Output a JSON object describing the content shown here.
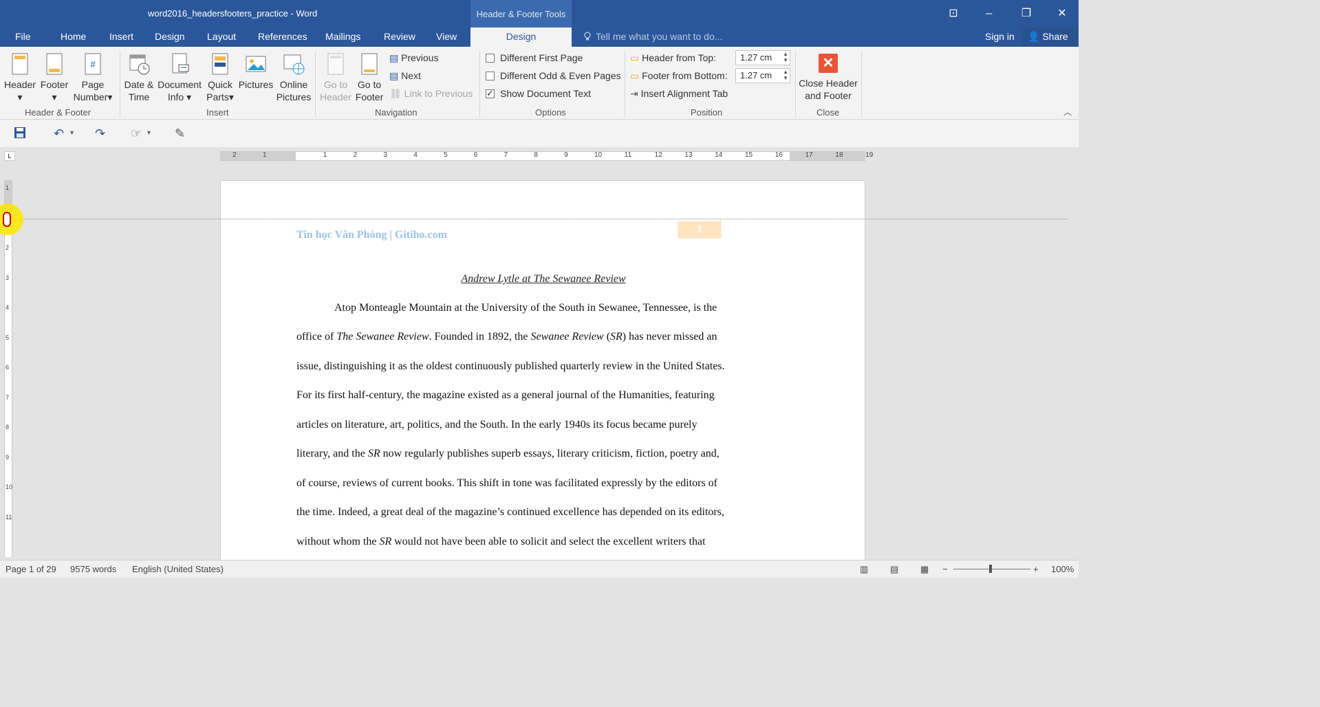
{
  "window": {
    "title": "word2016_headersfooters_practice - Word",
    "context_tab_group": "Header & Footer Tools"
  },
  "tabs": [
    "File",
    "Home",
    "Insert",
    "Design",
    "Layout",
    "References",
    "Mailings",
    "Review",
    "View",
    "Design"
  ],
  "tell_me_placeholder": "Tell me what you want to do...",
  "account": {
    "signin": "Sign in",
    "share": "Share"
  },
  "ribbon": {
    "header_footer_group": {
      "label": "Header & Footer",
      "header": "Header",
      "footer": "Footer",
      "page_number_1": "Page",
      "page_number_2": "Number"
    },
    "insert_group": {
      "label": "Insert",
      "date_time_1": "Date &",
      "date_time_2": "Time",
      "document_info_1": "Document",
      "document_info_2": "Info",
      "quick_parts_1": "Quick",
      "quick_parts_2": "Parts",
      "pictures": "Pictures",
      "online_pictures_1": "Online",
      "online_pictures_2": "Pictures"
    },
    "navigation_group": {
      "label": "Navigation",
      "goto_header_1": "Go to",
      "goto_header_2": "Header",
      "goto_footer_1": "Go to",
      "goto_footer_2": "Footer",
      "previous": "Previous",
      "next": "Next",
      "link_to_previous": "Link to Previous"
    },
    "options_group": {
      "label": "Options",
      "different_first_page": "Different First Page",
      "different_odd_even": "Different Odd & Even Pages",
      "show_document_text": "Show Document Text",
      "different_first_page_checked": false,
      "different_odd_even_checked": false,
      "show_document_text_checked": true
    },
    "position_group": {
      "label": "Position",
      "header_from_top": "Header from Top:",
      "header_from_top_value": "1.27 cm",
      "footer_from_bottom": "Footer from Bottom:",
      "footer_from_bottom_value": "1.27 cm",
      "insert_alignment_tab": "Insert Alignment Tab"
    },
    "close_group": {
      "label": "Close",
      "close_1": "Close Header",
      "close_2": "and Footer"
    }
  },
  "ruler": {
    "horizontal_numbers": [
      "2",
      "1",
      "1",
      "2",
      "3",
      "4",
      "5",
      "6",
      "7",
      "8",
      "9",
      "10",
      "11",
      "12",
      "13",
      "14",
      "15",
      "16",
      "17",
      "18",
      "19"
    ],
    "vertical_numbers": [
      "1",
      "1",
      "2",
      "3",
      "4",
      "5",
      "6",
      "7",
      "8",
      "9",
      "10",
      "11"
    ]
  },
  "document": {
    "header_text": "Tin học Văn Phòng | Gitiho.com",
    "page_number": "1",
    "heading": "Andrew Lytle at The Sewanee Review",
    "lines": [
      {
        "a": "Atop Monteagle Mountain at the University of the South in Sewanee, Tennessee, is the"
      },
      {
        "a": "office of ",
        "i1": "The Sewanee Review",
        "b": ". Founded in 1892, the ",
        "i2": "Sewanee Review",
        "c": " (",
        "i3": "SR",
        "d": ") has never missed an"
      },
      {
        "a": "issue, distinguishing it as the oldest continuously published quarterly review in the United States."
      },
      {
        "a": "For its first half-century, the magazine existed as a general journal of the Humanities, featuring"
      },
      {
        "a": "articles on literature, art, politics, and the South. In the early 1940s its focus became purely"
      },
      {
        "a": "literary, and the ",
        "i1": "SR",
        "b": " now regularly publishes superb essays, literary criticism, fiction, poetry and,"
      },
      {
        "a": "of course, reviews of current books. This shift in tone was facilitated expressly by the editors of"
      },
      {
        "a": "the time. Indeed, a great deal of the magazine’s continued excellence has depended on its editors,"
      },
      {
        "a": "without whom the ",
        "i1": "SR",
        "b": " would not have been able to solicit and select the excellent writers that"
      }
    ]
  },
  "status": {
    "page": "Page 1 of 29",
    "words": "9575 words",
    "language": "English (United States)",
    "zoom": "100%",
    "zoom_minus": "−",
    "zoom_plus": "+"
  }
}
